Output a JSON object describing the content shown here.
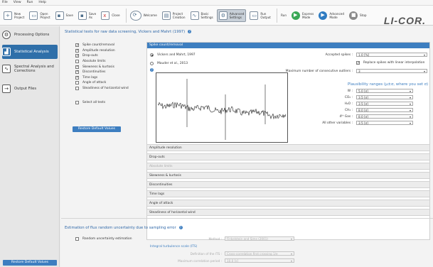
{
  "menu": [
    "File",
    "View",
    "Run",
    "Help"
  ],
  "toolbar": {
    "new_project": "New\nProject",
    "open_project": "Open\nProject",
    "save": "Save",
    "save_as": "Save\nAs",
    "close": "Close",
    "welcome": "Welcome",
    "project_creation": "Project\nCreation",
    "basic_settings": "Basic\nSettings",
    "advanced_settings": "Advanced\nSettings",
    "run_output": "Run\nOutput",
    "run": "Run",
    "express_mode": "Express\nMode",
    "advanced_mode": "Advanced\nMode",
    "stop": "Stop",
    "logo": "LI-COR."
  },
  "sidebar": {
    "items": [
      {
        "label": "Processing Options",
        "icon": "gear-icon"
      },
      {
        "label": "Statistical Analysis",
        "icon": "chart-icon"
      },
      {
        "label": "Spectral Analysis and Corrections",
        "icon": "spectrum-icon"
      },
      {
        "label": "Output Files",
        "icon": "export-icon"
      }
    ],
    "restore": "Restore Default Values"
  },
  "main": {
    "title": "Statistical tests for raw data screening, Vickers and Mahrt (1997)",
    "tests": [
      {
        "label": "Spike count/removal",
        "checked": true
      },
      {
        "label": "Amplitude resolution",
        "checked": true
      },
      {
        "label": "Drop-outs",
        "checked": true
      },
      {
        "label": "Absolute limits",
        "checked": false
      },
      {
        "label": "Skewness & kurtosis",
        "checked": true
      },
      {
        "label": "Discontinuities",
        "checked": true
      },
      {
        "label": "Time lags",
        "checked": true
      },
      {
        "label": "Angle of attack",
        "checked": false
      },
      {
        "label": "Steadiness of horizontal wind",
        "checked": false
      }
    ],
    "select_all": "Select all tests",
    "restore": "Restore Default Values",
    "panel": {
      "header": "Spike count/removal",
      "method1": "Vickers and Mahrt, 1997",
      "method2": "Mauder et al., 2013",
      "accepted_label": "Accepted spikes :",
      "accepted_value": "1.0 [%]",
      "replace_label": "Replace spikes with linear interpolation",
      "maxcons_label": "Maximum number of consecutive outliers :",
      "maxcons_value": "3",
      "plaus_title": "Plausibility ranges (μ±σ, where you set σ)",
      "ranges": [
        {
          "label": "W :",
          "value": "5.0 [σ]"
        },
        {
          "label": "CO₂ :",
          "value": "3.5 [σ]"
        },
        {
          "label": "H₂O :",
          "value": "3.5 [σ]"
        },
        {
          "label": "CH₄ :",
          "value": "8.0 [σ]"
        },
        {
          "label": "4ᵗʰ Gas :",
          "value": "8.0 [σ]"
        },
        {
          "label": "All other variables :",
          "value": "3.5 [σ]"
        }
      ]
    },
    "sections": [
      {
        "label": "Amplitude resolution",
        "dim": false
      },
      {
        "label": "Drop-outs",
        "dim": false
      },
      {
        "label": "Absolute limits",
        "dim": true
      },
      {
        "label": "Skewness & kurtosis",
        "dim": false
      },
      {
        "label": "Discontinuities",
        "dim": false
      },
      {
        "label": "Time lags",
        "dim": false
      },
      {
        "label": "Angle of attack",
        "dim": false
      },
      {
        "label": "Steadiness of horizontal wind",
        "dim": false
      }
    ],
    "uncertainty_title": "Estimation of flux random uncertainty due to sampling error",
    "uncertainty_check": "Random uncertainty estimation",
    "method_label": "Method :",
    "method_value": "Finkelstein and Sims (2001)",
    "its_label": "Integral turbulence scale (ITS)",
    "its_def_label": "Definition of the ITS :",
    "its_def_value": "Cross-correlation first crossing 1/e",
    "maxcorr_label": "Maximum correlation period :",
    "maxcorr_value": "10.0 [s]"
  },
  "colors": {
    "accent": "#3d7ec0",
    "sidebar_selected": "#2f6fa9",
    "frame": "#1ba99f"
  }
}
